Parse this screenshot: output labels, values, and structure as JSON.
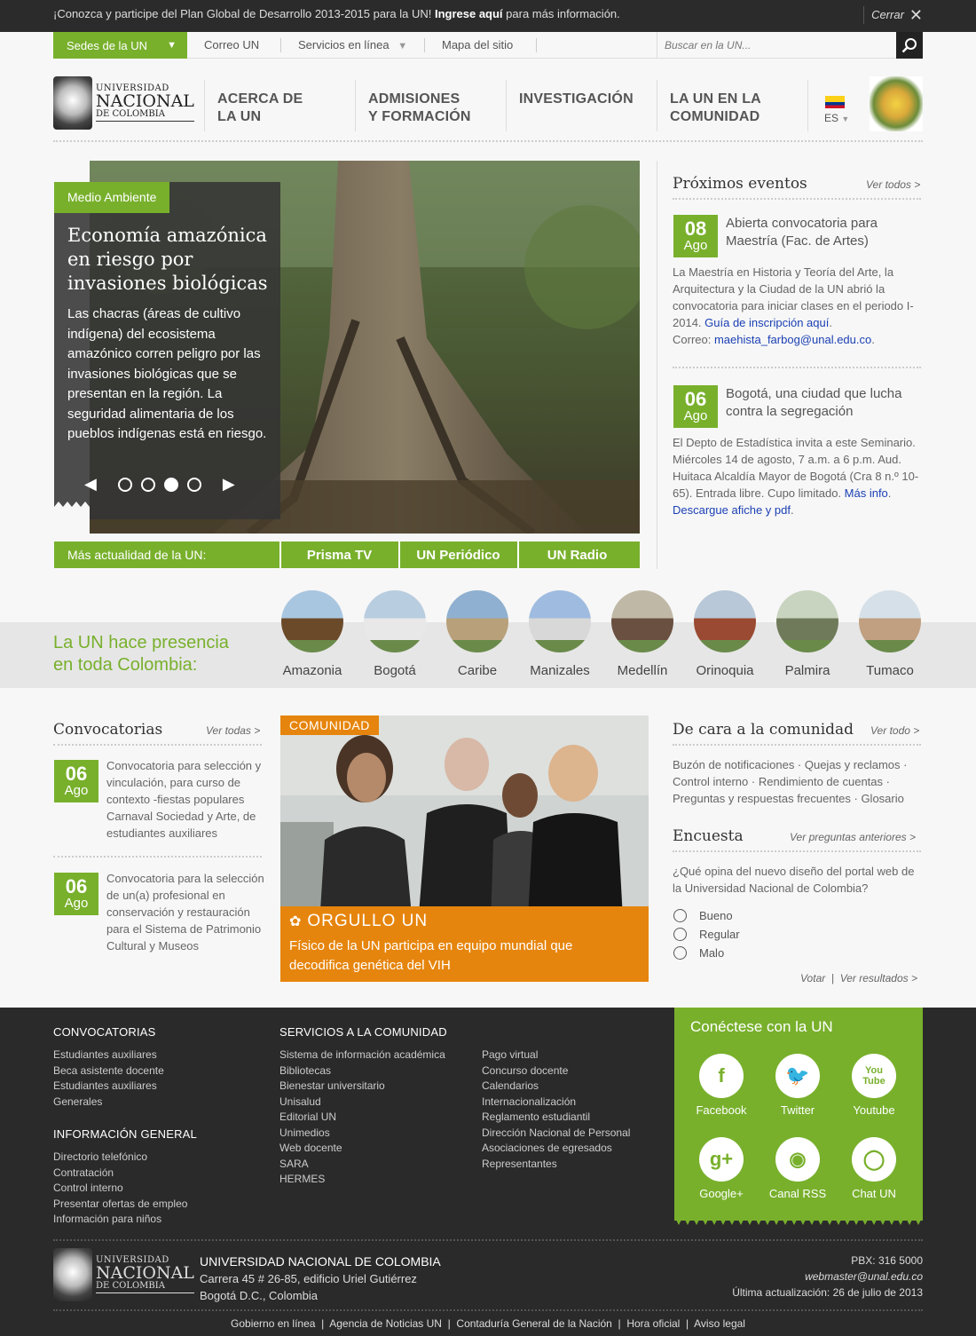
{
  "topbar": {
    "message_pre": "¡Conozca y participe del Plan Global de Desarrollo 2013-2015 para la UN! ",
    "message_link": "Ingrese aquí",
    "message_post": " para más información.",
    "close_label": "Cerrar"
  },
  "nav": {
    "sedes_label": "Sedes de la UN",
    "links": [
      "Correo UN",
      "Servicios en línea",
      "Mapa del sitio"
    ],
    "search_placeholder": "Buscar en la UN..."
  },
  "logo": {
    "line1": "UNIVERSIDAD",
    "line2": "NACIONAL",
    "line3": "DE COLOMBIA"
  },
  "mainnav": [
    {
      "l1": "ACERCA DE",
      "l2": "LA UN"
    },
    {
      "l1": "ADMISIONES",
      "l2": "Y FORMACIÓN"
    },
    {
      "l1": "INVESTIGACIÓN",
      "l2": ""
    },
    {
      "l1": "LA UN EN LA",
      "l2": "COMUNIDAD"
    }
  ],
  "lang": "ES",
  "hero": {
    "tag": "Medio Ambiente",
    "title": "Economía amazónica en riesgo por invasiones biológicas",
    "text": "Las chacras (áreas de cultivo indígena) del ecosistema amazónico corren peligro por las invasiones biológicas que se presentan en la región. La seguridad alimentaria de los pueblos indígenas está en riesgo.",
    "slides_total": 4,
    "slide_active": 3
  },
  "morebar": {
    "label": "Más actualidad de la UN:",
    "buttons": [
      "Prisma TV",
      "UN Periódico",
      "UN Radio"
    ]
  },
  "events": {
    "title": "Próximos eventos",
    "see_all": "Ver todos >",
    "items": [
      {
        "day": "08",
        "month": "Ago",
        "title": "Abierta convocatoria para Maestría (Fac. de Artes)",
        "text": "La Maestría en Historia y Teoría del Arte, la Arquitectura y la Ciudad de la UN abrió la convocatoria para iniciar clases en el periodo I-2014. ",
        "link1": "Guía de inscripción aquí",
        "text2": "Correo: ",
        "link2": "maehista_farbog@unal.edu.co"
      },
      {
        "day": "06",
        "month": "Ago",
        "title": "Bogotá, una ciudad que lucha contra la segregación",
        "text": "El Depto de Estadística invita a este Seminario. Miércoles 14 de agosto, 7 a.m. a 6 p.m. Aud. Huitaca Alcaldía Mayor de Bogotá (Cra 8 n.º 10-65). Entrada libre. Cupo limitado. ",
        "link1": "Más info",
        "link2": "Descargue afiche y pdf"
      }
    ]
  },
  "presence": {
    "title_l1": "La UN hace presencia",
    "title_l2": "en toda Colombia:",
    "sedes": [
      "Amazonia",
      "Bogotá",
      "Caribe",
      "Manizales",
      "Medellín",
      "Orinoquia",
      "Palmira",
      "Tumaco"
    ]
  },
  "convocatorias": {
    "title": "Convocatorias",
    "see_all": "Ver todas >",
    "items": [
      {
        "day": "06",
        "month": "Ago",
        "text": "Convocatoria para selección y vinculación, para curso de contexto -fiestas populares Carnaval Sociedad y Arte, de estudiantes auxiliares"
      },
      {
        "day": "06",
        "month": "Ago",
        "text": "Convocatoria para la selección de un(a) profesional en conservación y restauración para el Sistema de Patrimonio Cultural y Museos"
      }
    ]
  },
  "comunidad": {
    "tag": "COMUNIDAD",
    "brand": "ORGULLO UN",
    "title": "Físico de la UN participa en equipo mundial que decodifica genética del VIH"
  },
  "cara": {
    "title": "De cara a la comunidad",
    "see_all": "Ver todo >",
    "text": "Buzón de notificaciones · Quejas y reclamos · Control interno · Rendimiento de cuentas · Preguntas y respuestas frecuentes · Glosario"
  },
  "encuesta": {
    "title": "Encuesta",
    "see_prev": "Ver preguntas anteriores >",
    "question": "¿Qué opina del nuevo diseño del portal web de la Universidad Nacional de Colombia?",
    "options": [
      "Bueno",
      "Regular",
      "Malo"
    ],
    "vote": "Votar",
    "results": "Ver resultados >"
  },
  "footer": {
    "convocatorias_title": "CONVOCATORIAS",
    "convocatorias": [
      "Estudiantes auxiliares",
      "Beca asistente docente",
      "Estudiantes auxiliares",
      "Generales"
    ],
    "info_title": "INFORMACIÓN GENERAL",
    "info": [
      "Directorio telefónico",
      "Contratación",
      "Control interno",
      "Presentar ofertas de empleo",
      "Información para niños"
    ],
    "servicios_title": "SERVICIOS A LA COMUNIDAD",
    "servicios1": [
      "Sistema de información académica",
      "Bibliotecas",
      "Bienestar universitario",
      "Unisalud",
      "Editorial UN",
      "Unimedios",
      "Web docente",
      "SARA",
      "HERMES"
    ],
    "servicios2": [
      "Pago virtual",
      "Concurso docente",
      "Calendarios",
      "Internacionalización",
      "Reglamento estudiantil",
      "Dirección Nacional de Personal",
      "Asociaciones de egresados",
      "Representantes"
    ],
    "social_title": "Conéctese con la UN",
    "social": [
      "Facebook",
      "Twitter",
      "Youtube",
      "Google+",
      "Canal RSS",
      "Chat UN"
    ],
    "addr_title": "UNIVERSIDAD NACIONAL DE COLOMBIA",
    "addr1": "Carrera 45 # 26-85, edificio Uriel Gutiérrez",
    "addr2": "Bogotá D.C., Colombia",
    "pbx": "PBX: 316 5000",
    "email": "webmaster@unal.edu.co",
    "updated": "Última actualización: 26 de julio de 2013",
    "links": [
      "Gobierno en línea",
      "Agencia de Noticias UN",
      "Contaduría General de la Nación",
      "Hora oficial",
      "Aviso legal"
    ]
  },
  "colors": {
    "green": "#78b02c",
    "orange": "#e6850d",
    "dark": "#2b2a2b"
  }
}
